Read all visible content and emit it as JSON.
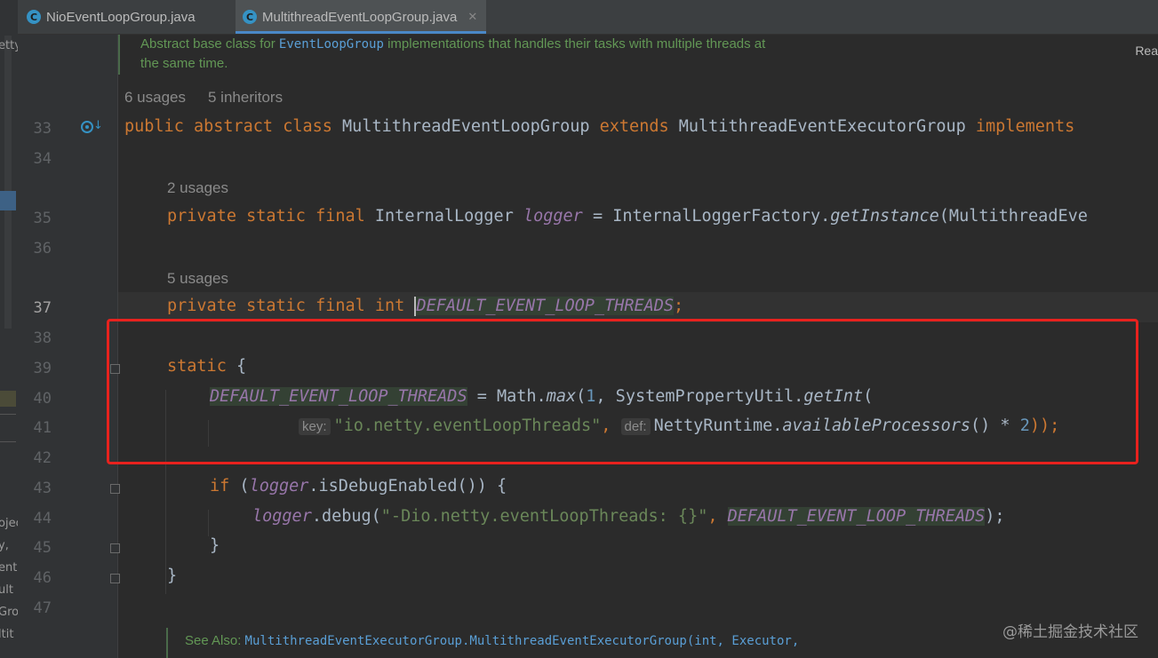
{
  "tabs": [
    {
      "label": "NioEventLoopGroup.java",
      "icon": "class-icon",
      "icon_letter": "C"
    },
    {
      "label": "MultithreadEventLoopGroup.java",
      "icon": "class-icon",
      "icon_letter": "C",
      "active": true
    }
  ],
  "left_strip_texts": [
    "etty",
    "ojec",
    "y,",
    "ent",
    "ult",
    "Gro",
    "ltit",
    "ith"
  ],
  "doc": {
    "line1_pre": "Abstract base class for ",
    "line1_ref": "EventLoopGroup",
    "line1_post": " implementations that handles their tasks with multiple threads at",
    "line2": "the same time."
  },
  "reader_mode_label": "Rea",
  "hints": {
    "class_usages": "6 usages",
    "class_inheritors": "5 inheritors",
    "logger_usages": "2 usages",
    "threads_usages": "5 usages"
  },
  "line_numbers": [
    "33",
    "34",
    "35",
    "36",
    "37",
    "38",
    "39",
    "40",
    "41",
    "42",
    "43",
    "44",
    "45",
    "46",
    "47"
  ],
  "code": {
    "l33": {
      "kw1": "public abstract class ",
      "name": "MultithreadEventLoopGroup ",
      "kw2": "extends ",
      "parent": "MultithreadEventExecutorGroup ",
      "kw3": "implements"
    },
    "l35": {
      "kw": "private static final ",
      "type": "InternalLogger ",
      "field": "logger",
      "eq": " = InternalLoggerFactory.",
      "method": "getInstance",
      "rest": "(MultithreadEve"
    },
    "l37": {
      "kw": "private static final int ",
      "field": "DEFAULT_EVENT_LOOP_THREADS",
      "semi": ";"
    },
    "l39": {
      "kw": "static ",
      "brace": "{"
    },
    "l40": {
      "field": "DEFAULT_EVENT_LOOP_THREADS",
      "mid": " = Math.",
      "method": "max",
      "p1": "(",
      "num": "1",
      "mid2": ", SystemPropertyUtil.",
      "method2": "getInt",
      "p2": "("
    },
    "l41": {
      "hint_key": "key:",
      "str": "\"io.netty.eventLoopThreads\"",
      "comma": ", ",
      "hint_def": "def:",
      "cls": "NettyRuntime.",
      "method": "availableProcessors",
      "rest": "() * ",
      "num": "2",
      "end": "));"
    },
    "l43": {
      "kw": "if ",
      "p": "(",
      "field": "logger",
      "rest": ".isDebugEnabled()) {"
    },
    "l44": {
      "field": "logger",
      "mid": ".debug(",
      "str": "\"-Dio.netty.eventLoopThreads: {}\"",
      "comma": ", ",
      "field2": "DEFAULT_EVENT_LOOP_THREADS",
      "end": ");"
    },
    "l45": "}",
    "l46": "}"
  },
  "see_also": {
    "label": "See Also: ",
    "ref": "MultithreadEventExecutorGroup.MultithreadEventExecutorGroup(int, Executor,"
  },
  "watermark": "@稀土掘金技术社区",
  "colors": {
    "keyword": "#cc7832",
    "field": "#9876aa",
    "string": "#6a8759",
    "number": "#6897bb",
    "doc": "#629755",
    "highlight_box": "#e8221e"
  }
}
